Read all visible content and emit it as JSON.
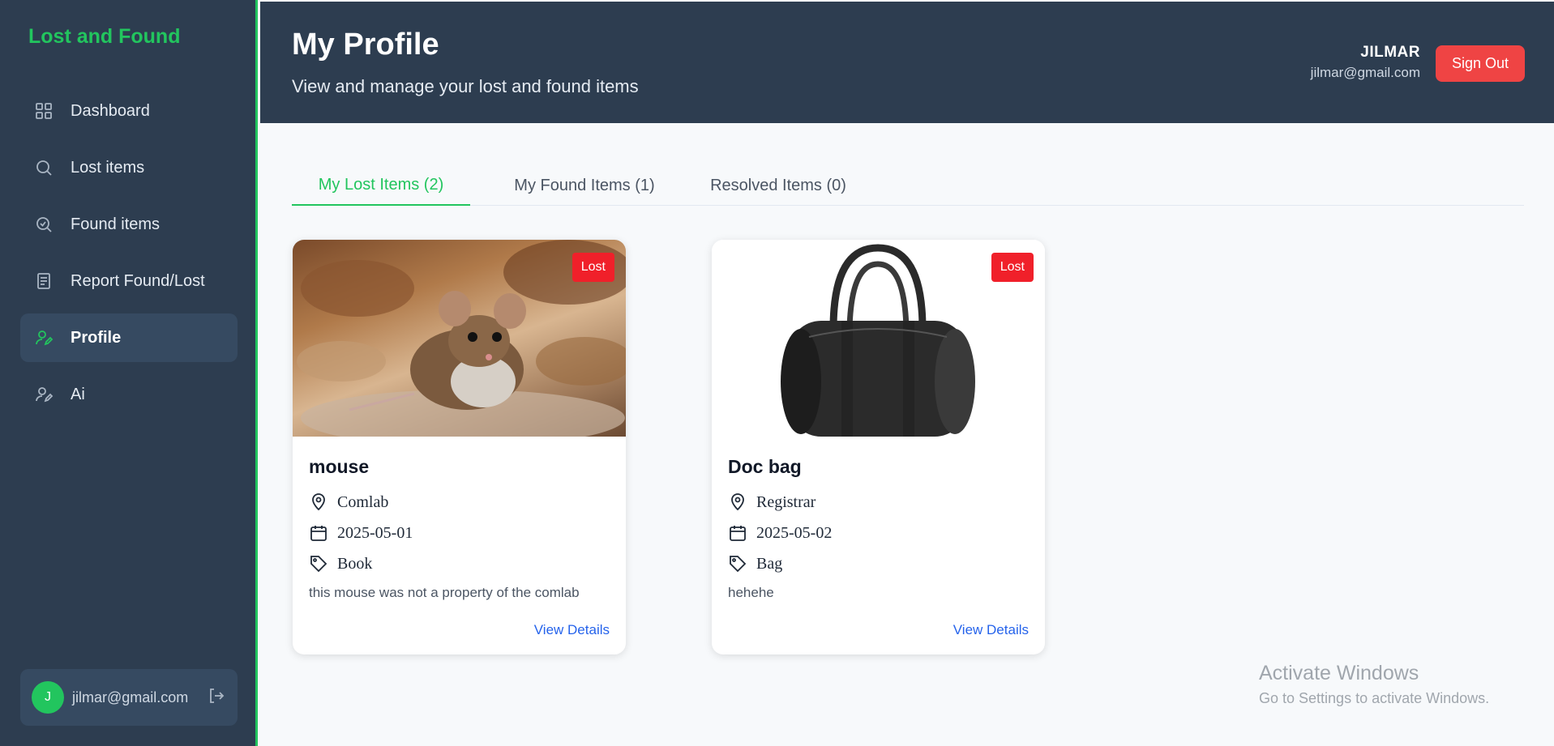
{
  "sidebar": {
    "brand": "Lost and Found",
    "items": [
      {
        "label": "Dashboard",
        "icon": "grid-icon"
      },
      {
        "label": "Lost items",
        "icon": "search-icon"
      },
      {
        "label": "Found items",
        "icon": "search-check-icon"
      },
      {
        "label": "Report Found/Lost",
        "icon": "document-icon"
      },
      {
        "label": "Profile",
        "icon": "user-edit-icon",
        "active": true
      },
      {
        "label": "Ai",
        "icon": "user-edit-icon"
      }
    ],
    "user": {
      "initial": "J",
      "email": "jilmar@gmail.com"
    }
  },
  "header": {
    "title": "My Profile",
    "subtitle": "View and manage your lost and found items",
    "user_name": "JILMAR",
    "user_email": "jilmar@gmail.com",
    "signout_label": "Sign Out"
  },
  "tabs": [
    {
      "label": "My Lost Items (2)",
      "active": true
    },
    {
      "label": "My Found Items (1)",
      "active": false
    },
    {
      "label": "Resolved Items (0)",
      "active": false
    }
  ],
  "items": [
    {
      "title": "mouse",
      "status": "Lost",
      "location": "Comlab",
      "date": "2025-05-01",
      "category": "Book",
      "description": "this mouse was not a property of the comlab",
      "link": "View Details"
    },
    {
      "title": "Doc bag",
      "status": "Lost",
      "location": "Registrar",
      "date": "2025-05-02",
      "category": "Bag",
      "description": "hehehe",
      "link": "View Details"
    }
  ],
  "watermark": {
    "title": "Activate Windows",
    "subtitle": "Go to Settings to activate Windows."
  },
  "colors": {
    "accent": "#22c55e",
    "sidebar_bg": "#2d3d50",
    "danger": "#ef4444",
    "link": "#2563eb"
  }
}
